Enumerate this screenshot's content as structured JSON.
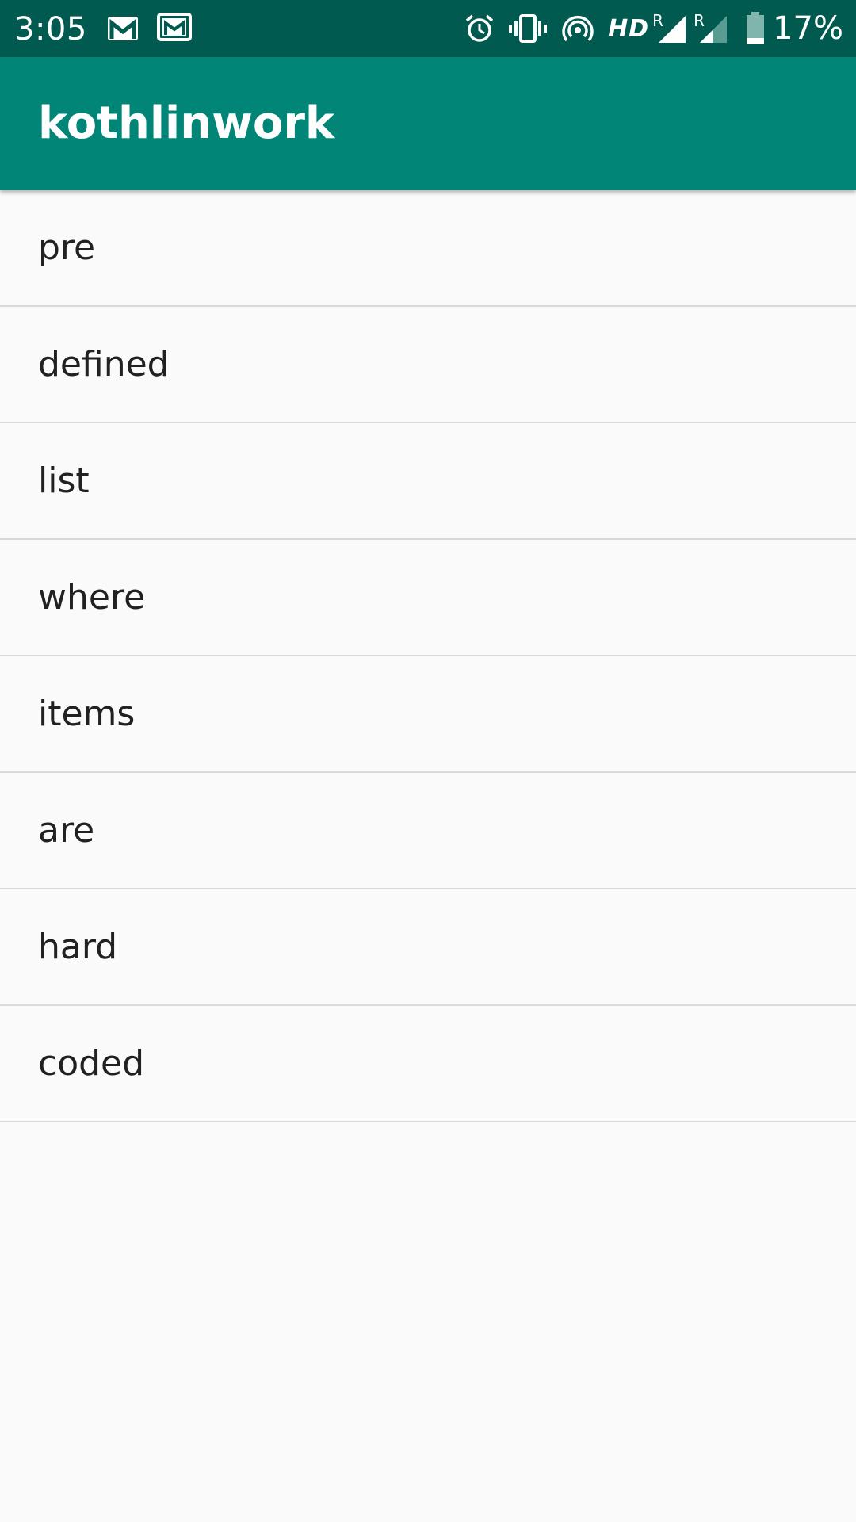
{
  "status_bar": {
    "time": "3:05",
    "hd": "HD",
    "roaming_1": "R",
    "roaming_2": "R",
    "battery_percent": "17%",
    "icons_left": [
      "gmail-icon",
      "gmail-icon"
    ],
    "icons_right": [
      "alarm-icon",
      "vibrate-icon",
      "hotspot-icon",
      "hd-icon",
      "signal-icon",
      "signal-icon",
      "battery-icon"
    ],
    "background_color": "#005a4f"
  },
  "app_bar": {
    "title": "kothlinwork",
    "background_color": "#008577"
  },
  "list": {
    "items": [
      {
        "label": "pre"
      },
      {
        "label": "defined"
      },
      {
        "label": "list"
      },
      {
        "label": "where"
      },
      {
        "label": "items"
      },
      {
        "label": "are"
      },
      {
        "label": "hard"
      },
      {
        "label": "coded"
      }
    ]
  }
}
